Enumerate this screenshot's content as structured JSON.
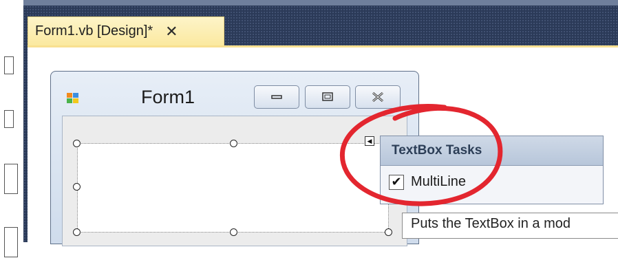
{
  "document_tab": {
    "title": "Form1.vb [Design]*",
    "close_icon": "close-icon",
    "close_glyph": "✕"
  },
  "form": {
    "title": "Form1",
    "icon": "form-icon"
  },
  "caption_buttons": [
    "minimize-icon",
    "maximize-icon",
    "close-icon"
  ],
  "smart_tag": {
    "glyph": "◀"
  },
  "tasks_panel": {
    "title": "TextBox Tasks",
    "multiline": {
      "label": "MultiLine",
      "checked": true,
      "check_glyph": "✔"
    }
  },
  "tooltip": {
    "text": "Puts the TextBox in a mod"
  },
  "colors": {
    "ide_background": "#2b3a58",
    "tab_active": "#fbe9a0",
    "annotation": "#e3262f"
  }
}
